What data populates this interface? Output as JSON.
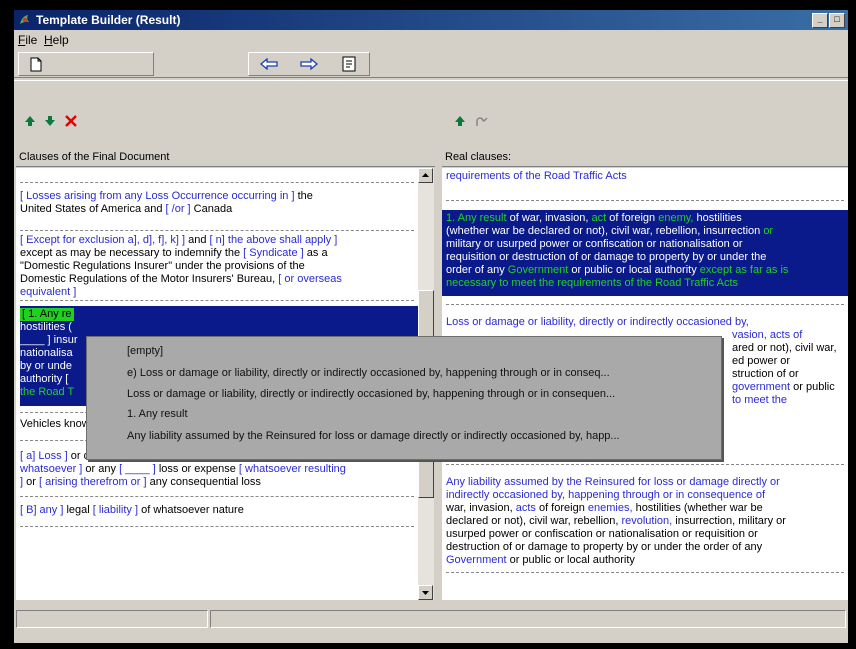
{
  "window": {
    "title": "Template Builder (Result)"
  },
  "menu": {
    "file": "File",
    "help": "Help"
  },
  "left": {
    "header": "Clauses of the Final Document",
    "clauses": [
      {
        "lines": [
          [
            {
              "t": "[ Losses arising from any Loss Occurrence occurring in ]",
              "c": "blu"
            },
            {
              "t": " the",
              "c": ""
            }
          ],
          [
            {
              "t": "United States of America and ",
              "c": ""
            },
            {
              "t": "[ /or ]",
              "c": "blu"
            },
            {
              "t": " Canada",
              "c": ""
            }
          ]
        ]
      },
      {
        "lines": [
          [
            {
              "t": "[ Except for exclusion a], d], f], k] ]",
              "c": "blu"
            },
            {
              "t": " and ",
              "c": ""
            },
            {
              "t": "[ n] the above shall apply ]",
              "c": "blu"
            }
          ],
          [
            {
              "t": "except as may be necessary to indemnify the ",
              "c": ""
            },
            {
              "t": "[ Syndicate ]",
              "c": "blu"
            },
            {
              "t": " as a",
              "c": ""
            }
          ],
          [
            {
              "t": "\"Domestic Regulations Insurer\" under the provisions of the",
              "c": ""
            }
          ],
          [
            {
              "t": "Domestic Regulations of the Motor Insurers' Bureau, ",
              "c": ""
            },
            {
              "t": "[ or overseas",
              "c": "blu"
            }
          ],
          [
            {
              "t": "equivalent ]",
              "c": "blu"
            }
          ]
        ]
      },
      {
        "sel_lines": [
          "[ 1. Any re",
          "hostilities (",
          "____ ] insur",
          "nationalisa",
          "by or unde",
          "authority [",
          "the Road T"
        ]
      },
      {
        "lines": [
          [
            {
              "t": "Vehicles known to be carrying hazardous goods or to be agreed",
              "c": ""
            }
          ]
        ]
      },
      {
        "lines": [
          [
            {
              "t": "[ a] Loss ]",
              "c": "blu"
            },
            {
              "t": " or destruction of or damage to any property ",
              "c": ""
            },
            {
              "t": "[",
              "c": "blu"
            }
          ],
          [
            {
              "t": "whatsoever ]",
              "c": "blu"
            },
            {
              "t": " or any ",
              "c": ""
            },
            {
              "t": "[ ____ ]",
              "c": "blu"
            },
            {
              "t": " loss or expense ",
              "c": ""
            },
            {
              "t": "[ whatsoever resulting",
              "c": "blu"
            }
          ],
          [
            {
              "t": "]",
              "c": "blu"
            },
            {
              "t": " or ",
              "c": ""
            },
            {
              "t": "[ arising therefrom or ]",
              "c": "blu"
            },
            {
              "t": " any consequential loss",
              "c": ""
            }
          ]
        ]
      },
      {
        "lines": [
          [
            {
              "t": "[ B] any ]",
              "c": "blu"
            },
            {
              "t": " legal ",
              "c": ""
            },
            {
              "t": "[ liability ]",
              "c": "blu"
            },
            {
              "t": " of whatsoever nature",
              "c": ""
            }
          ]
        ]
      }
    ]
  },
  "right": {
    "header": "Real clauses:",
    "top_line": "requirements of the Road Traffic Acts",
    "selected_clause": [
      [
        {
          "t": "1. Any result",
          "c": "grn"
        },
        {
          "t": " of war, invasion, ",
          "c": ""
        },
        {
          "t": "act",
          "c": "grn"
        },
        {
          "t": " of foreign ",
          "c": ""
        },
        {
          "t": "enemy,",
          "c": "grn"
        },
        {
          "t": " hostilities",
          "c": ""
        }
      ],
      [
        {
          "t": "(whether war be declared or not), civil war, rebellion, insurrection ",
          "c": ""
        },
        {
          "t": "or",
          "c": "grn"
        }
      ],
      [
        {
          "t": "military or usurped power or confiscation or nationalisation or",
          "c": ""
        }
      ],
      [
        {
          "t": "requisition or destruction of or damage to property by or under the",
          "c": ""
        }
      ],
      [
        {
          "t": "order of any ",
          "c": ""
        },
        {
          "t": "Government",
          "c": "grn"
        },
        {
          "t": " or public or local authority ",
          "c": ""
        },
        {
          "t": "except as far as is",
          "c": "grn"
        }
      ],
      [
        {
          "t": "necessary to meet the requirements of the Road Traffic Acts",
          "c": "grn"
        }
      ]
    ],
    "clause2": [
      [
        {
          "t": "Loss or damage or liability, directly or indirectly occasioned by,",
          "c": "blu"
        }
      ],
      [
        {
          "t": "vasion, acts of",
          "c": "blu"
        }
      ],
      [
        {
          "t": "ared or not), civil war,",
          "c": ""
        }
      ],
      [
        {
          "t": "ed power or",
          "c": ""
        }
      ],
      [
        {
          "t": "struction of or",
          "c": ""
        }
      ],
      [
        {
          "t": "government",
          "c": "blu"
        },
        {
          "t": " or public",
          "c": ""
        }
      ],
      [
        {
          "t": "to meet the",
          "c": "blu"
        }
      ]
    ],
    "clause3": [
      [
        {
          "t": "Any liability assumed by the Reinsured for loss or damage directly or",
          "c": "blu"
        }
      ],
      [
        {
          "t": "indirectly occasioned by, happening through or in consequence of",
          "c": "blu"
        }
      ],
      [
        {
          "t": "war, invasion, ",
          "c": ""
        },
        {
          "t": "acts",
          "c": "blu"
        },
        {
          "t": " of foreign ",
          "c": ""
        },
        {
          "t": "enemies,",
          "c": "blu"
        },
        {
          "t": " hostilities (whether war be",
          "c": ""
        }
      ],
      [
        {
          "t": "declared or not), civil war, rebellion, ",
          "c": ""
        },
        {
          "t": "revolution,",
          "c": "blu"
        },
        {
          "t": " insurrection, military or",
          "c": ""
        }
      ],
      [
        {
          "t": "usurped power or confiscation or nationalisation or requisition or",
          "c": ""
        }
      ],
      [
        {
          "t": "destruction of or damage to property by or under the order of any",
          "c": ""
        }
      ],
      [
        {
          "t": "Government",
          "c": "blu"
        },
        {
          "t": " or public or local authority",
          "c": ""
        }
      ]
    ]
  },
  "popup": {
    "items": [
      "[empty]",
      "e) Loss or damage or liability, directly or indirectly occasioned by, happening through or in conseq...",
      "Loss or damage or liability, directly or indirectly occasioned by, happening through or in consequen...",
      "1. Any result",
      "Any liability assumed by the Reinsured for loss or damage directly or indirectly occasioned by, happ..."
    ]
  },
  "colors": {
    "link_blue": "#2a2ad4",
    "highlight_green": "#22d022",
    "selection_navy": "#0a1a8a",
    "delete_red": "#e00000",
    "arrow_green": "#0a7a3a"
  },
  "icons": {
    "new": "document-icon",
    "back": "arrow-left-icon",
    "forward": "arrow-right-icon",
    "props": "properties-icon",
    "up": "arrow-up-icon",
    "down": "arrow-down-icon",
    "delete": "delete-x-icon",
    "insert": "insert-icon",
    "redo": "redo-icon"
  }
}
